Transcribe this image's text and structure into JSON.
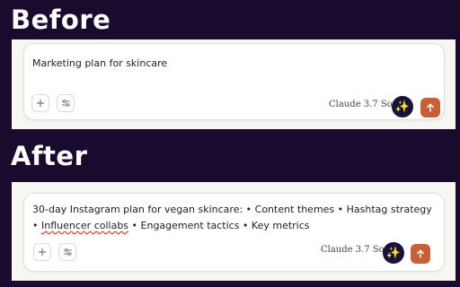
{
  "before": {
    "heading": "Before",
    "prompt_text": "Marketing plan for skincare",
    "model_label": "Claude 3.7 Sonnet",
    "icons": {
      "plus": "plus-icon",
      "settings": "sliders-icon",
      "enhance": "sparkles-icon",
      "send": "arrow-up-icon"
    }
  },
  "after": {
    "heading": "After",
    "prompt_text_parts": [
      "30-day Instagram plan for vegan skincare: • Content themes • Hashtag strategy • ",
      "Influencer collabs",
      " • Engagement tactics • Key metrics"
    ],
    "model_label": "Claude 3.7 Sonnet",
    "icons": {
      "plus": "plus-icon",
      "settings": "sliders-icon",
      "enhance": "sparkles-icon",
      "send": "arrow-up-icon"
    }
  },
  "colors": {
    "background": "#1a0b2e",
    "send_button": "#c85f38",
    "enhance_button": "#17123a"
  }
}
